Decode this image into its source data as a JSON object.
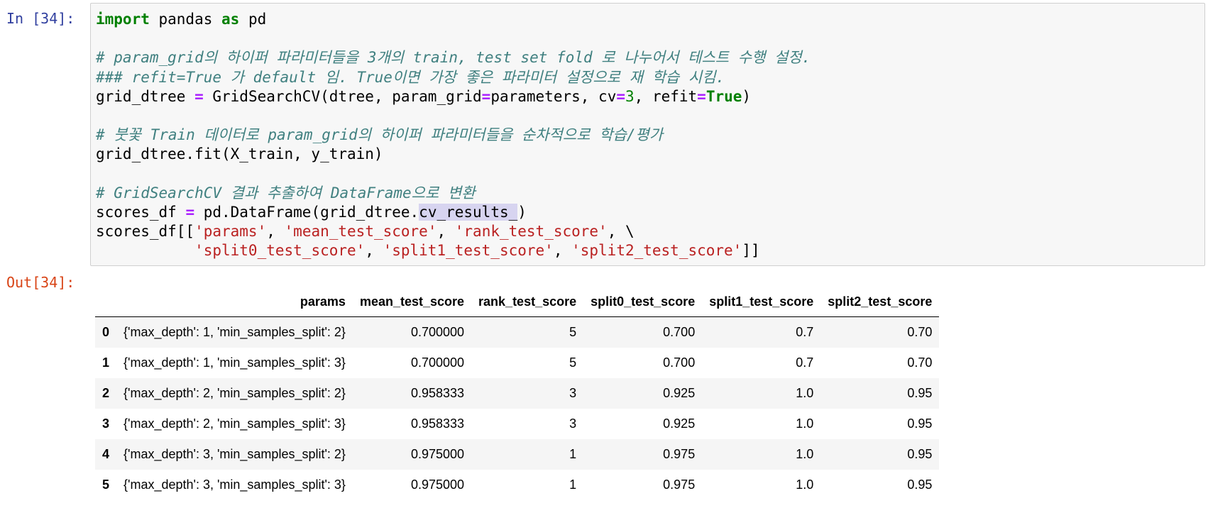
{
  "cell": {
    "in_prompt": "In [34]:",
    "out_prompt": "Out[34]:"
  },
  "code": {
    "line1": {
      "kw1": "import",
      "mid": " pandas ",
      "kw2": "as",
      "end": " pd"
    },
    "comment1": "# param_grid의 하이퍼 파라미터들을 3개의 train, test set fold 로 나누어서 테스트 수행 설정.",
    "comment2": "### refit=True 가 default 임. True이면 가장 좋은 파라미터 설정으로 재 학습 시킴.",
    "grid_line": {
      "var": "grid_dtree ",
      "eq": "=",
      "call": " GridSearchCV(dtree, param_grid",
      "eq2": "=",
      "arg": "parameters, cv",
      "eq3": "=",
      "cv": "3",
      "sep": ", refit",
      "eq4": "=",
      "refit": "True",
      "close": ")"
    },
    "comment3": "# 붓꽃 Train 데이터로 param_grid의 하이퍼 파라미터들을 순차적으로 학습/평가",
    "fit_line": "grid_dtree.fit(X_train, y_train)",
    "comment4": "# GridSearchCV 결과 추출하여 DataFrame으로 변환",
    "scores_line": {
      "var": "scores_df ",
      "eq": "=",
      "call": " pd.DataFrame(grid_dtree.",
      "attr": "cv_results_",
      "close": ")"
    },
    "select_line1": {
      "start": "scores_df[[",
      "s1": "'params'",
      "c1": ", ",
      "s2": "'mean_test_score'",
      "c2": ", ",
      "s3": "'rank_test_score'",
      "end": ", \\"
    },
    "select_line2": {
      "indent": "           ",
      "s4": "'split0_test_score'",
      "c1": ", ",
      "s5": "'split1_test_score'",
      "c2": ", ",
      "s6": "'split2_test_score'",
      "end": "]]"
    }
  },
  "table": {
    "columns": [
      "",
      "params",
      "mean_test_score",
      "rank_test_score",
      "split0_test_score",
      "split1_test_score",
      "split2_test_score"
    ],
    "rows": [
      {
        "index": "0",
        "params": "{'max_depth': 1, 'min_samples_split': 2}",
        "mean": "0.700000",
        "rank": "5",
        "s0": "0.700",
        "s1": "0.7",
        "s2": "0.70"
      },
      {
        "index": "1",
        "params": "{'max_depth': 1, 'min_samples_split': 3}",
        "mean": "0.700000",
        "rank": "5",
        "s0": "0.700",
        "s1": "0.7",
        "s2": "0.70"
      },
      {
        "index": "2",
        "params": "{'max_depth': 2, 'min_samples_split': 2}",
        "mean": "0.958333",
        "rank": "3",
        "s0": "0.925",
        "s1": "1.0",
        "s2": "0.95"
      },
      {
        "index": "3",
        "params": "{'max_depth': 2, 'min_samples_split': 3}",
        "mean": "0.958333",
        "rank": "3",
        "s0": "0.925",
        "s1": "1.0",
        "s2": "0.95"
      },
      {
        "index": "4",
        "params": "{'max_depth': 3, 'min_samples_split': 2}",
        "mean": "0.975000",
        "rank": "1",
        "s0": "0.975",
        "s1": "1.0",
        "s2": "0.95"
      },
      {
        "index": "5",
        "params": "{'max_depth': 3, 'min_samples_split': 3}",
        "mean": "0.975000",
        "rank": "1",
        "s0": "0.975",
        "s1": "1.0",
        "s2": "0.95"
      }
    ]
  }
}
